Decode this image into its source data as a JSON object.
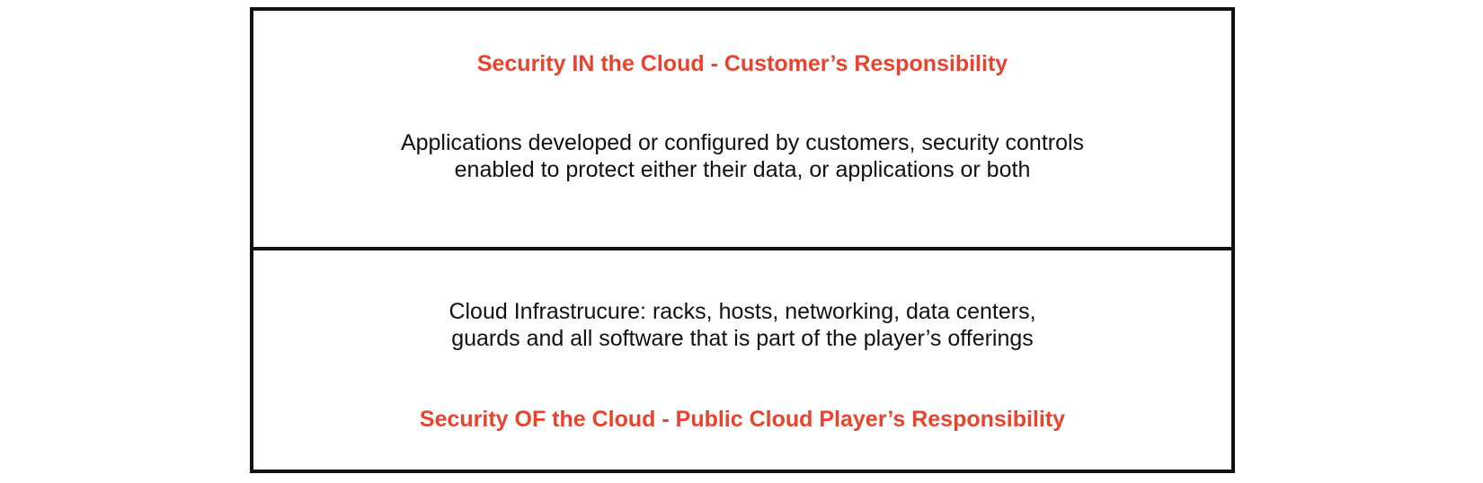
{
  "accent_color": "#e8432d",
  "top_panel": {
    "heading": "Security IN the Cloud - Customer’s Responsibility",
    "lines": [
      "Applications developed or configured by customers, security controls",
      "enabled to protect either their data, or applications or both"
    ]
  },
  "bottom_panel": {
    "lines": [
      "Cloud Infrastrucure: racks, hosts, networking, data centers,",
      "guards and all software that is part of the player’s offerings"
    ],
    "heading": "Security OF the Cloud - Public Cloud Player’s Responsibility"
  }
}
